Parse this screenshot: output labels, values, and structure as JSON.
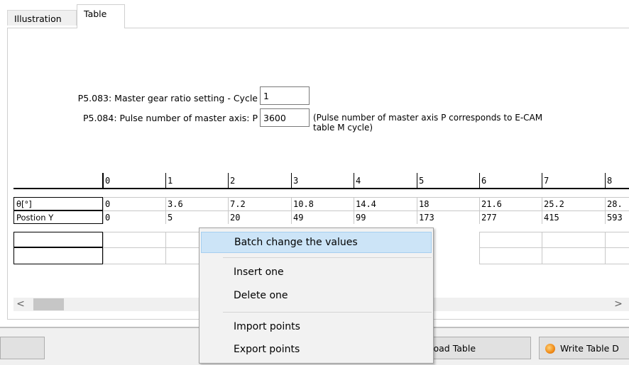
{
  "tabs": [
    {
      "label": "Illustration",
      "active": false
    },
    {
      "label": "Table",
      "active": true
    }
  ],
  "params": {
    "p5083_label": "P5.083: Master gear ratio setting - Cycle",
    "p5083_value": "1",
    "p5084_label": "P5.084: Pulse number of master axis: P",
    "p5084_value": "3600",
    "p5084_note_line1": "(Pulse number of master axis P corresponds to E-CAM",
    "p5084_note_line2": "table M cycle)"
  },
  "table": {
    "columns": [
      "0",
      "1",
      "2",
      "3",
      "4",
      "5",
      "6",
      "7",
      "8"
    ],
    "rows": [
      {
        "header": "θ[°]",
        "values": [
          "0",
          "3.6",
          "7.2",
          "10.8",
          "14.4",
          "18",
          "21.6",
          "25.2",
          "28."
        ]
      },
      {
        "header": "Postion Y",
        "values": [
          "0",
          "5",
          "20",
          "49",
          "99",
          "173",
          "277",
          "415",
          "593"
        ]
      }
    ]
  },
  "scrollbar": {
    "left_arrow": "<",
    "right_arrow": ">"
  },
  "buttons": {
    "load_table": "load Table",
    "write_table": "Write Table D"
  },
  "context_menu": {
    "items": [
      {
        "label": "Batch change the values",
        "highlighted": true
      },
      {
        "label": "Insert one",
        "highlighted": false
      },
      {
        "label": "Delete one",
        "highlighted": false
      },
      {
        "label": "Import points",
        "highlighted": false
      },
      {
        "label": "Export points",
        "highlighted": false
      }
    ]
  },
  "colors": {
    "menu_highlight": "#cce4f7",
    "menu_background": "#f2f2f2",
    "window_background": "#f0f0f0",
    "write_icon": "#f08a16"
  }
}
